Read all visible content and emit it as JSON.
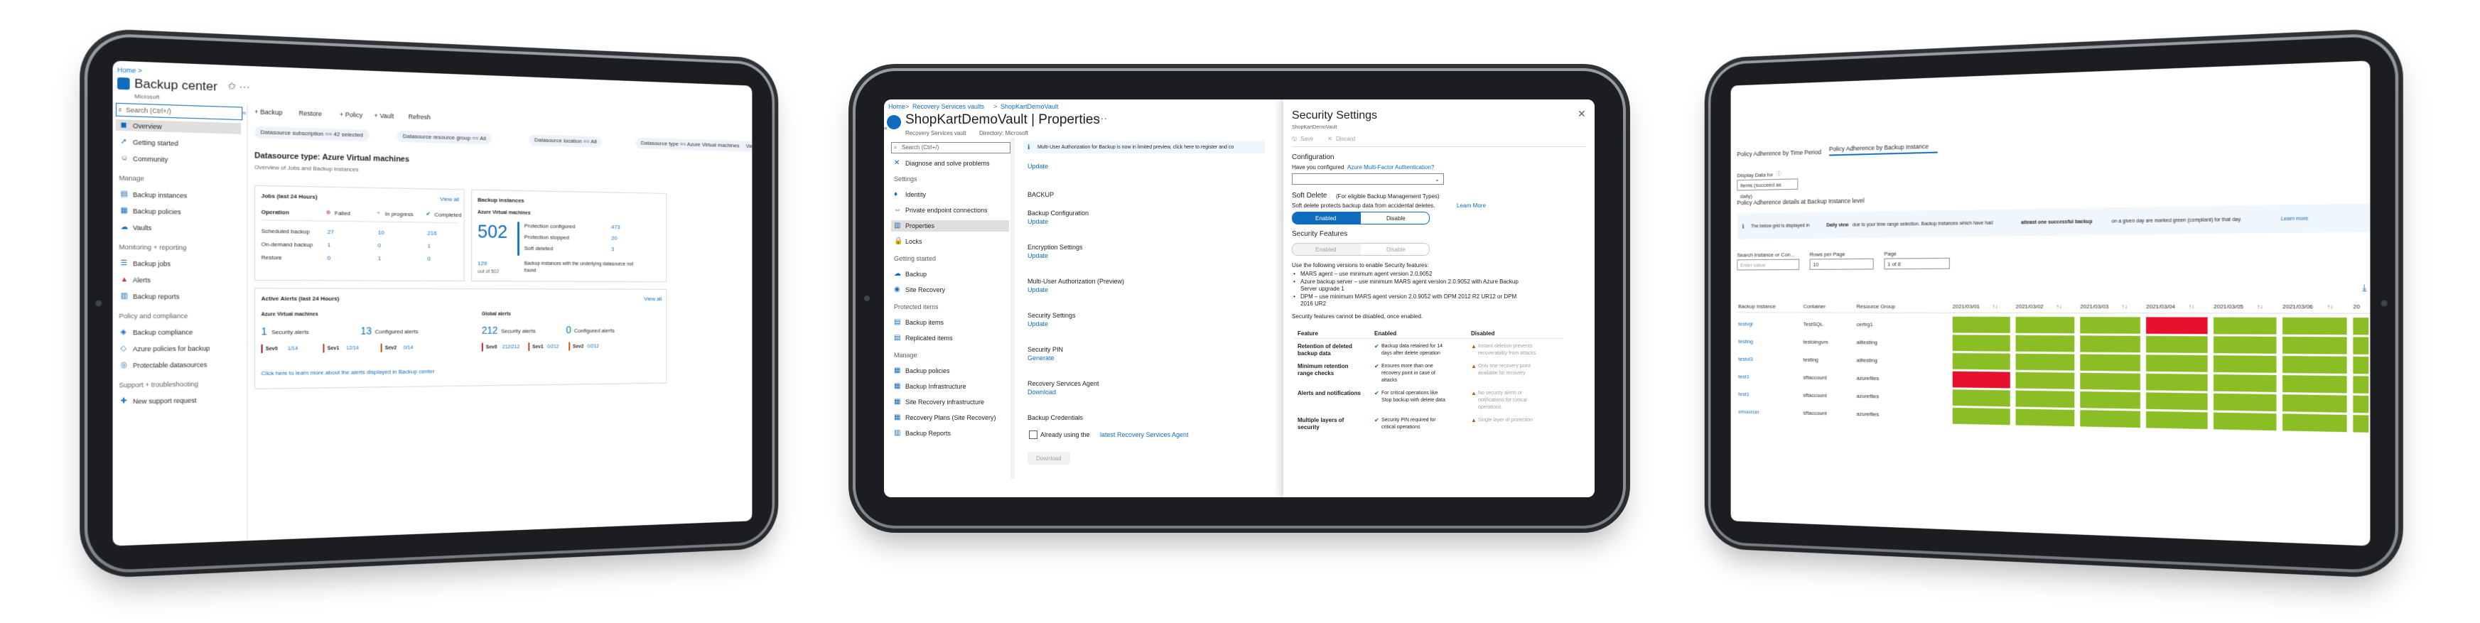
{
  "d1": {
    "breadcrumb": "Home >",
    "title": "Backup center",
    "subtitle": "Microsoft",
    "search_placeholder": "Search (Ctrl+/)",
    "toolbar": [
      "+ Backup",
      "Restore",
      "+ Policy",
      "+ Vault",
      "Refresh"
    ],
    "nav": [
      "Overview",
      "Getting started",
      "Community"
    ],
    "section_manage": "Manage",
    "nav_manage": [
      "Backup instances",
      "Backup policies",
      "Vaults"
    ],
    "section_monitoring": "Monitoring + reporting",
    "nav_monitoring": [
      "Backup jobs",
      "Alerts",
      "Backup reports"
    ],
    "section_policy": "Policy and compliance",
    "nav_policy": [
      "Backup compliance",
      "Azure policies for backup",
      "Protectable datasources"
    ],
    "section_support": "Support + troubleshooting",
    "nav_support": [
      "New support request"
    ],
    "filters": [
      "Datasource subscription == 42 selected",
      "Datasource resource group == All",
      "Datasource location == All",
      "Datasource type == Azure Virtual machines",
      "Vault == All"
    ],
    "heading": "Datasource type: Azure Virtual machines",
    "subheading": "Overview of Jobs and Backup Instances",
    "jobs": {
      "title": "Jobs (last 24 Hours)",
      "view_all": "View all",
      "col_operation": "Operation",
      "col_failed": "Failed",
      "col_inprogress": "In progress",
      "col_completed": "Completed",
      "rows": [
        {
          "op": "Scheduled backup",
          "failed": "27",
          "inprogress": "10",
          "completed": "216"
        },
        {
          "op": "On-demand backup",
          "failed": "1",
          "inprogress": "0",
          "completed": "1"
        },
        {
          "op": "Restore",
          "failed": "0",
          "inprogress": "1",
          "completed": "0"
        }
      ]
    },
    "instances": {
      "title": "Backup instances",
      "subtitle": "Azure Virtual machines",
      "count": "502",
      "rows": [
        {
          "label": "Protection configured",
          "value": "473"
        },
        {
          "label": "Protection stopped",
          "value": "20"
        },
        {
          "label": "Soft deleted",
          "value": "3"
        }
      ],
      "note_count": "129",
      "note_out": "out of 502",
      "note_text1": "Backup instances with the underlying datasource not",
      "note_text2": "found"
    },
    "alerts": {
      "title": "Active Alerts (last 24 Hours)",
      "view_all": "View all",
      "sub1": "Azure Virtual machines",
      "sub2": "Global alerts",
      "security_count": "1",
      "security_label": "Security alerts",
      "configured_count": "13",
      "configured_label": "Configured alerts",
      "sev": [
        "Sev0",
        "1/14",
        "Sev1",
        "12/14",
        "Sev2",
        "0/14"
      ],
      "g_security_count": "212",
      "g_security_label": "Security alerts",
      "g_configured_count": "0",
      "g_configured_label": "Configured alerts",
      "g_sev": [
        "Sev0",
        "212/212",
        "Sev1",
        "0/212",
        "Sev2",
        "0/212"
      ],
      "footer": "Click here to learn more about the alerts displayed in Backup center"
    }
  },
  "d2": {
    "breadcrumb": [
      "Home",
      "Recovery Services vaults",
      "ShopKartDemoVault"
    ],
    "title": "ShopKartDemoVault | Properties",
    "subtitle": "Recovery Services vault",
    "directory": "Directory: Microsoft",
    "search_placeholder": "Search (Ctrl+/)",
    "nav_top": [
      "Diagnose and solve problems"
    ],
    "section_settings": "Settings",
    "nav_settings": [
      "Identity",
      "Private endpoint connections",
      "Properties",
      "Locks"
    ],
    "section_getting_started": "Getting started",
    "nav_gs": [
      "Backup",
      "Site Recovery"
    ],
    "section_protected": "Protected items",
    "nav_protected": [
      "Backup items",
      "Replicated items"
    ],
    "section_manage": "Manage",
    "nav_manage": [
      "Backup policies",
      "Backup Infrastructure",
      "Site Recovery infrastructure",
      "Recovery Plans (Site Recovery)",
      "Backup Reports"
    ],
    "info_banner": "Multi-User Authorization for Backup is now in limited preview, click here to register and co",
    "update_top": "Update",
    "section_backup": "BACKUP",
    "props": [
      {
        "label": "Backup Configuration",
        "action": "Update"
      },
      {
        "label": "Encryption Settings",
        "action": "Update"
      },
      {
        "label": "Multi-User Authorization (Preview)",
        "action": "Update"
      },
      {
        "label": "Security Settings",
        "action": "Update"
      },
      {
        "label": "Security PIN",
        "action": "Generate"
      },
      {
        "label": "Recovery Services Agent",
        "action": "Download"
      }
    ],
    "credentials_label": "Backup Credentials",
    "checkbox_text": "Already using the",
    "checkbox_link": "latest Recovery Services Agent",
    "download_button": "Download"
  },
  "panel": {
    "title": "Security Settings",
    "subtitle": "ShopKartDemoVault",
    "save": "Save",
    "discard": "Discard",
    "config_label": "Configuration",
    "config_question": "Have you configured",
    "config_link": "Azure Multi-Factor Authentication?",
    "soft_delete_title": "Soft Delete",
    "soft_delete_suffix": "(For eligible Backup Management Types)",
    "soft_delete_desc": "Soft delete protects backup data from accidental deletes.",
    "learn_more": "Learn More",
    "enabled": "Enabled",
    "disable": "Disable",
    "security_features": "Security Features",
    "versions_intro": "Use the following versions to enable Security features:",
    "bullets": [
      "MARS agent – use minimum agent version 2.0.9052",
      "Azure backup server – use minimum MARS agent version 2.0.9052 with Azure Backup",
      "Server upgrade 1",
      "DPM – use minimum MARS agent version 2.0.9052 with DPM 2012 R2 UR12 or DPM",
      "2016 UR2"
    ],
    "cannot_disable": "Security features cannot be disabled, once enabled.",
    "table_headers": [
      "Feature",
      "Enabled",
      "Disabled"
    ],
    "rows": [
      {
        "feature": [
          "Retention of deleted",
          "backup data"
        ],
        "enabled": [
          "Backup data retained for 14",
          "days after delete operation"
        ],
        "disabled": [
          "Instant deletion prevents",
          "recoverability from attacks"
        ]
      },
      {
        "feature": [
          "Minimum retention",
          "range checks"
        ],
        "enabled": [
          "Ensures more than one",
          "recovery point in case of",
          "attacks"
        ],
        "disabled": [
          "Only one recovery point",
          "available for recovery"
        ]
      },
      {
        "feature": [
          "Alerts and notifications"
        ],
        "enabled": [
          "For critical operations like",
          "Stop backup with delete data"
        ],
        "disabled": [
          "No security alerts or",
          "notifications for critical",
          "operations"
        ]
      },
      {
        "feature": [
          "Multiple layers of",
          "security"
        ],
        "enabled": [
          "Security PIN required for",
          "critical operations"
        ],
        "disabled": [
          "Single layer of protection"
        ]
      }
    ]
  },
  "d3": {
    "tabs": [
      "Policy Adherence by Time Period",
      "Policy Adherence by Backup Instance"
    ],
    "display_label": "Display Data for",
    "display_value": "Items (succeed as daily)",
    "section_title": "Policy Adherence details at Backup Instance level",
    "banner": "The below grid is displayed in",
    "banner_bold": "Daily view",
    "banner_rest": "due to your time range selection. Backup instances which have had",
    "banner_bold2": "atleast one successful backup",
    "banner_end": "on a given day are marked green (compliant) for that day.",
    "banner_link": "Learn more",
    "search_label": "Search Instance or Con...",
    "search_placeholder": "Enter value",
    "rows_label": "Rows per Page",
    "rows_value": "10",
    "page_label": "Page",
    "page_value": "1 of 8",
    "col_headers": [
      "Backup Instance",
      "Container",
      "Resource Group"
    ],
    "date_headers": [
      "2021/03/01",
      "2021/03/02",
      "2021/03/03",
      "2021/03/04",
      "2021/03/05",
      "2021/03/06",
      "20"
    ],
    "rows": [
      {
        "instance": "testvgl",
        "container": "TestSQL",
        "rg": "certrg1"
      },
      {
        "instance": "testing",
        "container": "testoingvm",
        "rg": "alltesting"
      },
      {
        "instance": "testvl3",
        "container": "testing",
        "rg": "alltesting"
      },
      {
        "instance": "test1",
        "container": "sftaccount",
        "rg": "azurefiles"
      },
      {
        "instance": "test1",
        "container": "sftaccount",
        "rg": "azurefiles"
      },
      {
        "instance": "vmourcer",
        "container": "sftaccount",
        "rg": "azurefiles"
      }
    ],
    "grid": [
      [
        "ok",
        "ok",
        "ok",
        "fail",
        "ok",
        "ok",
        "ok"
      ],
      [
        "ok",
        "ok",
        "ok",
        "ok",
        "ok",
        "ok",
        "ok"
      ],
      [
        "ok",
        "ok",
        "ok",
        "ok",
        "ok",
        "ok",
        "ok"
      ],
      [
        "fail",
        "ok",
        "ok",
        "ok",
        "ok",
        "ok",
        "ok"
      ],
      [
        "ok",
        "ok",
        "ok",
        "ok",
        "ok",
        "ok",
        "ok"
      ],
      [
        "ok",
        "ok",
        "ok",
        "ok",
        "ok",
        "ok",
        "ok"
      ]
    ],
    "status_colors": {
      "ok": "#8bbd24",
      "fail": "#e8112d"
    }
  },
  "colors": {
    "accent": "#0f6cbd",
    "failed": "#d13438",
    "completed": "#107c10",
    "inprogress": "#0f6cbd"
  }
}
